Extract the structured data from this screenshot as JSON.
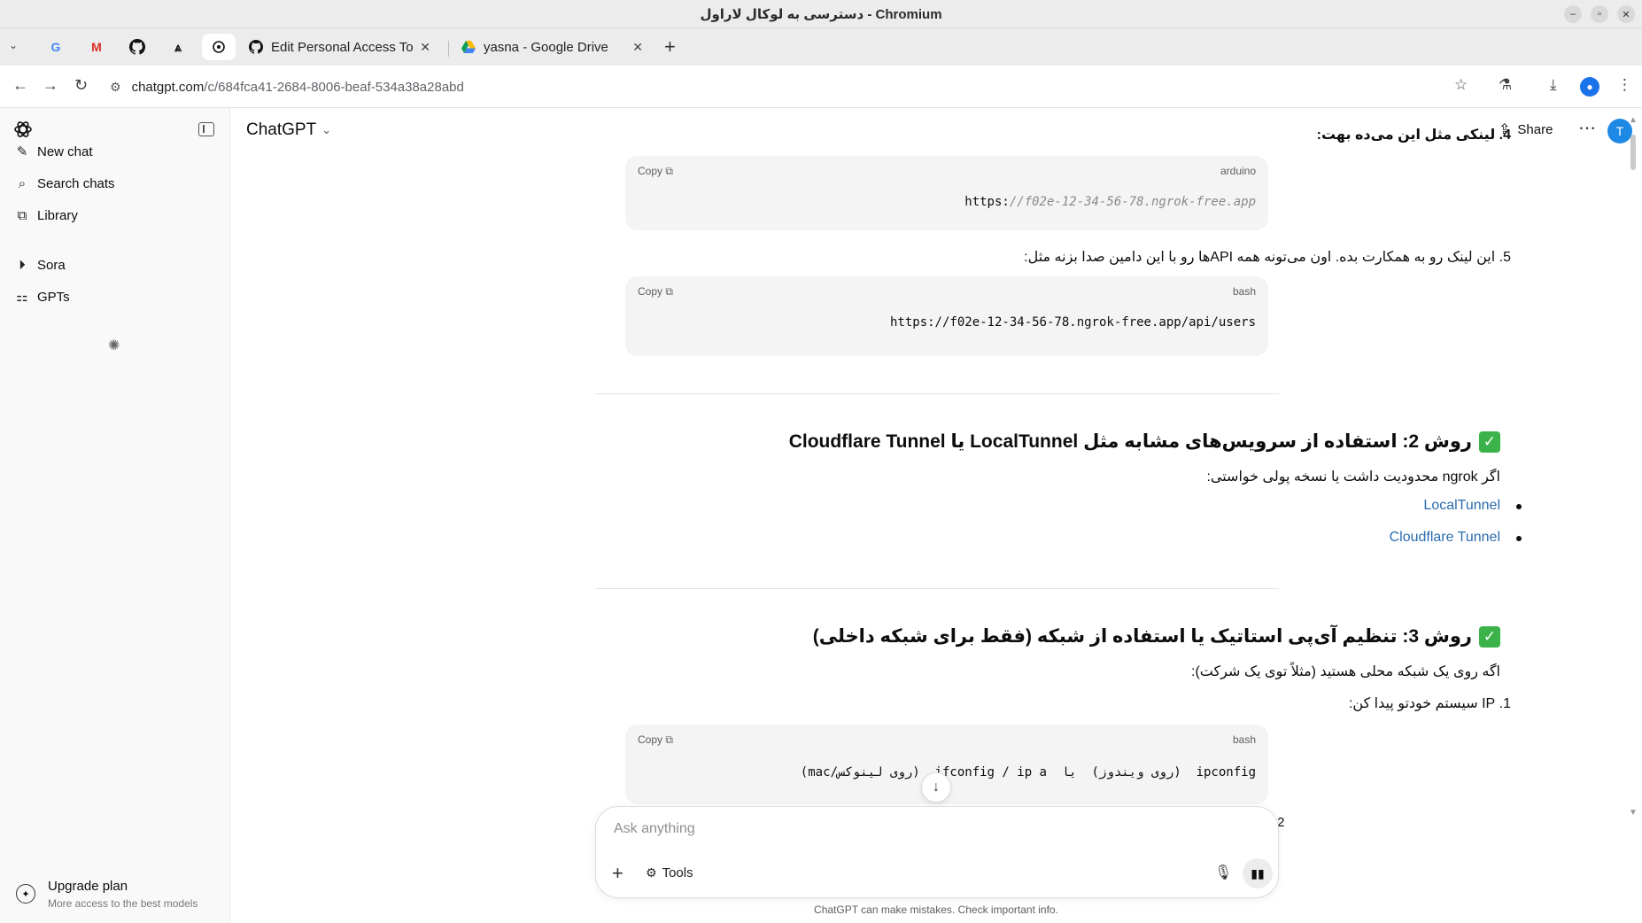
{
  "window": {
    "title": "دسترسی به لوکال لاراول - Chromium"
  },
  "tabs": [
    {
      "label": "Edit Personal Access Tok",
      "icon": "github-icon"
    },
    {
      "label": "yasna - Google Drive",
      "icon": "google-drive-icon"
    }
  ],
  "address_bar": {
    "host": "chatgpt.com",
    "path": "/c/684fca41-2684-8006-beaf-534a38a28abd"
  },
  "sidebar": {
    "items": [
      {
        "label": "New chat",
        "icon": "edit-icon"
      },
      {
        "label": "Search chats",
        "icon": "search-icon"
      },
      {
        "label": "Library",
        "icon": "library-icon"
      },
      {
        "label": "Sora",
        "icon": "play-circle-icon"
      },
      {
        "label": "GPTs",
        "icon": "grid-icon"
      }
    ],
    "upgrade": {
      "title": "Upgrade plan",
      "subtitle": "More access to the best models"
    }
  },
  "header": {
    "model": "ChatGPT",
    "share_label": "Share",
    "user_initial": "T"
  },
  "conversation": {
    "step4": "4. لینکی مثل این می‌ده بهت:",
    "code1": {
      "lang": "arduino",
      "copy": "Copy",
      "prefix": "https:",
      "rest": "//f02e-12-34-56-78.ngrok-free.app"
    },
    "step5": "5. این لینک رو به همکارت بده. اون می‌تونه همه APIها رو با این دامین صدا بزنه مثل:",
    "code2": {
      "lang": "bash",
      "copy": "Copy",
      "text": "https://f02e-12-34-56-78.ngrok-free.app/api/users"
    },
    "method2_heading": "روش 2: استفاده از سرویس‌های مشابه مثل LocalTunnel یا Cloudflare Tunnel",
    "method2_intro": "اگر ngrok محدودیت داشت یا نسخه پولی خواستی:",
    "links": [
      "LocalTunnel",
      "Cloudflare Tunnel"
    ],
    "method3_heading": "روش 3: تنظیم آی‌پی استاتیک یا استفاده از شبکه (فقط برای شبکه داخلی)",
    "method3_intro": "اگه روی یک شبکه محلی هستید (مثلاً توی یک شرکت):",
    "step1": "1. IP سیستم خودتو پیدا کن:",
    "code3": {
      "lang": "bash",
      "copy": "Copy",
      "text": "ipconfig  (روی ویندوز)  یا  ifconfig / ip a  (روی لینوکس/mac)"
    },
    "peek": "2."
  },
  "composer": {
    "placeholder": "Ask anything",
    "tools_label": "Tools"
  },
  "footer": {
    "disclaimer": "ChatGPT can make mistakes. Check important info."
  }
}
